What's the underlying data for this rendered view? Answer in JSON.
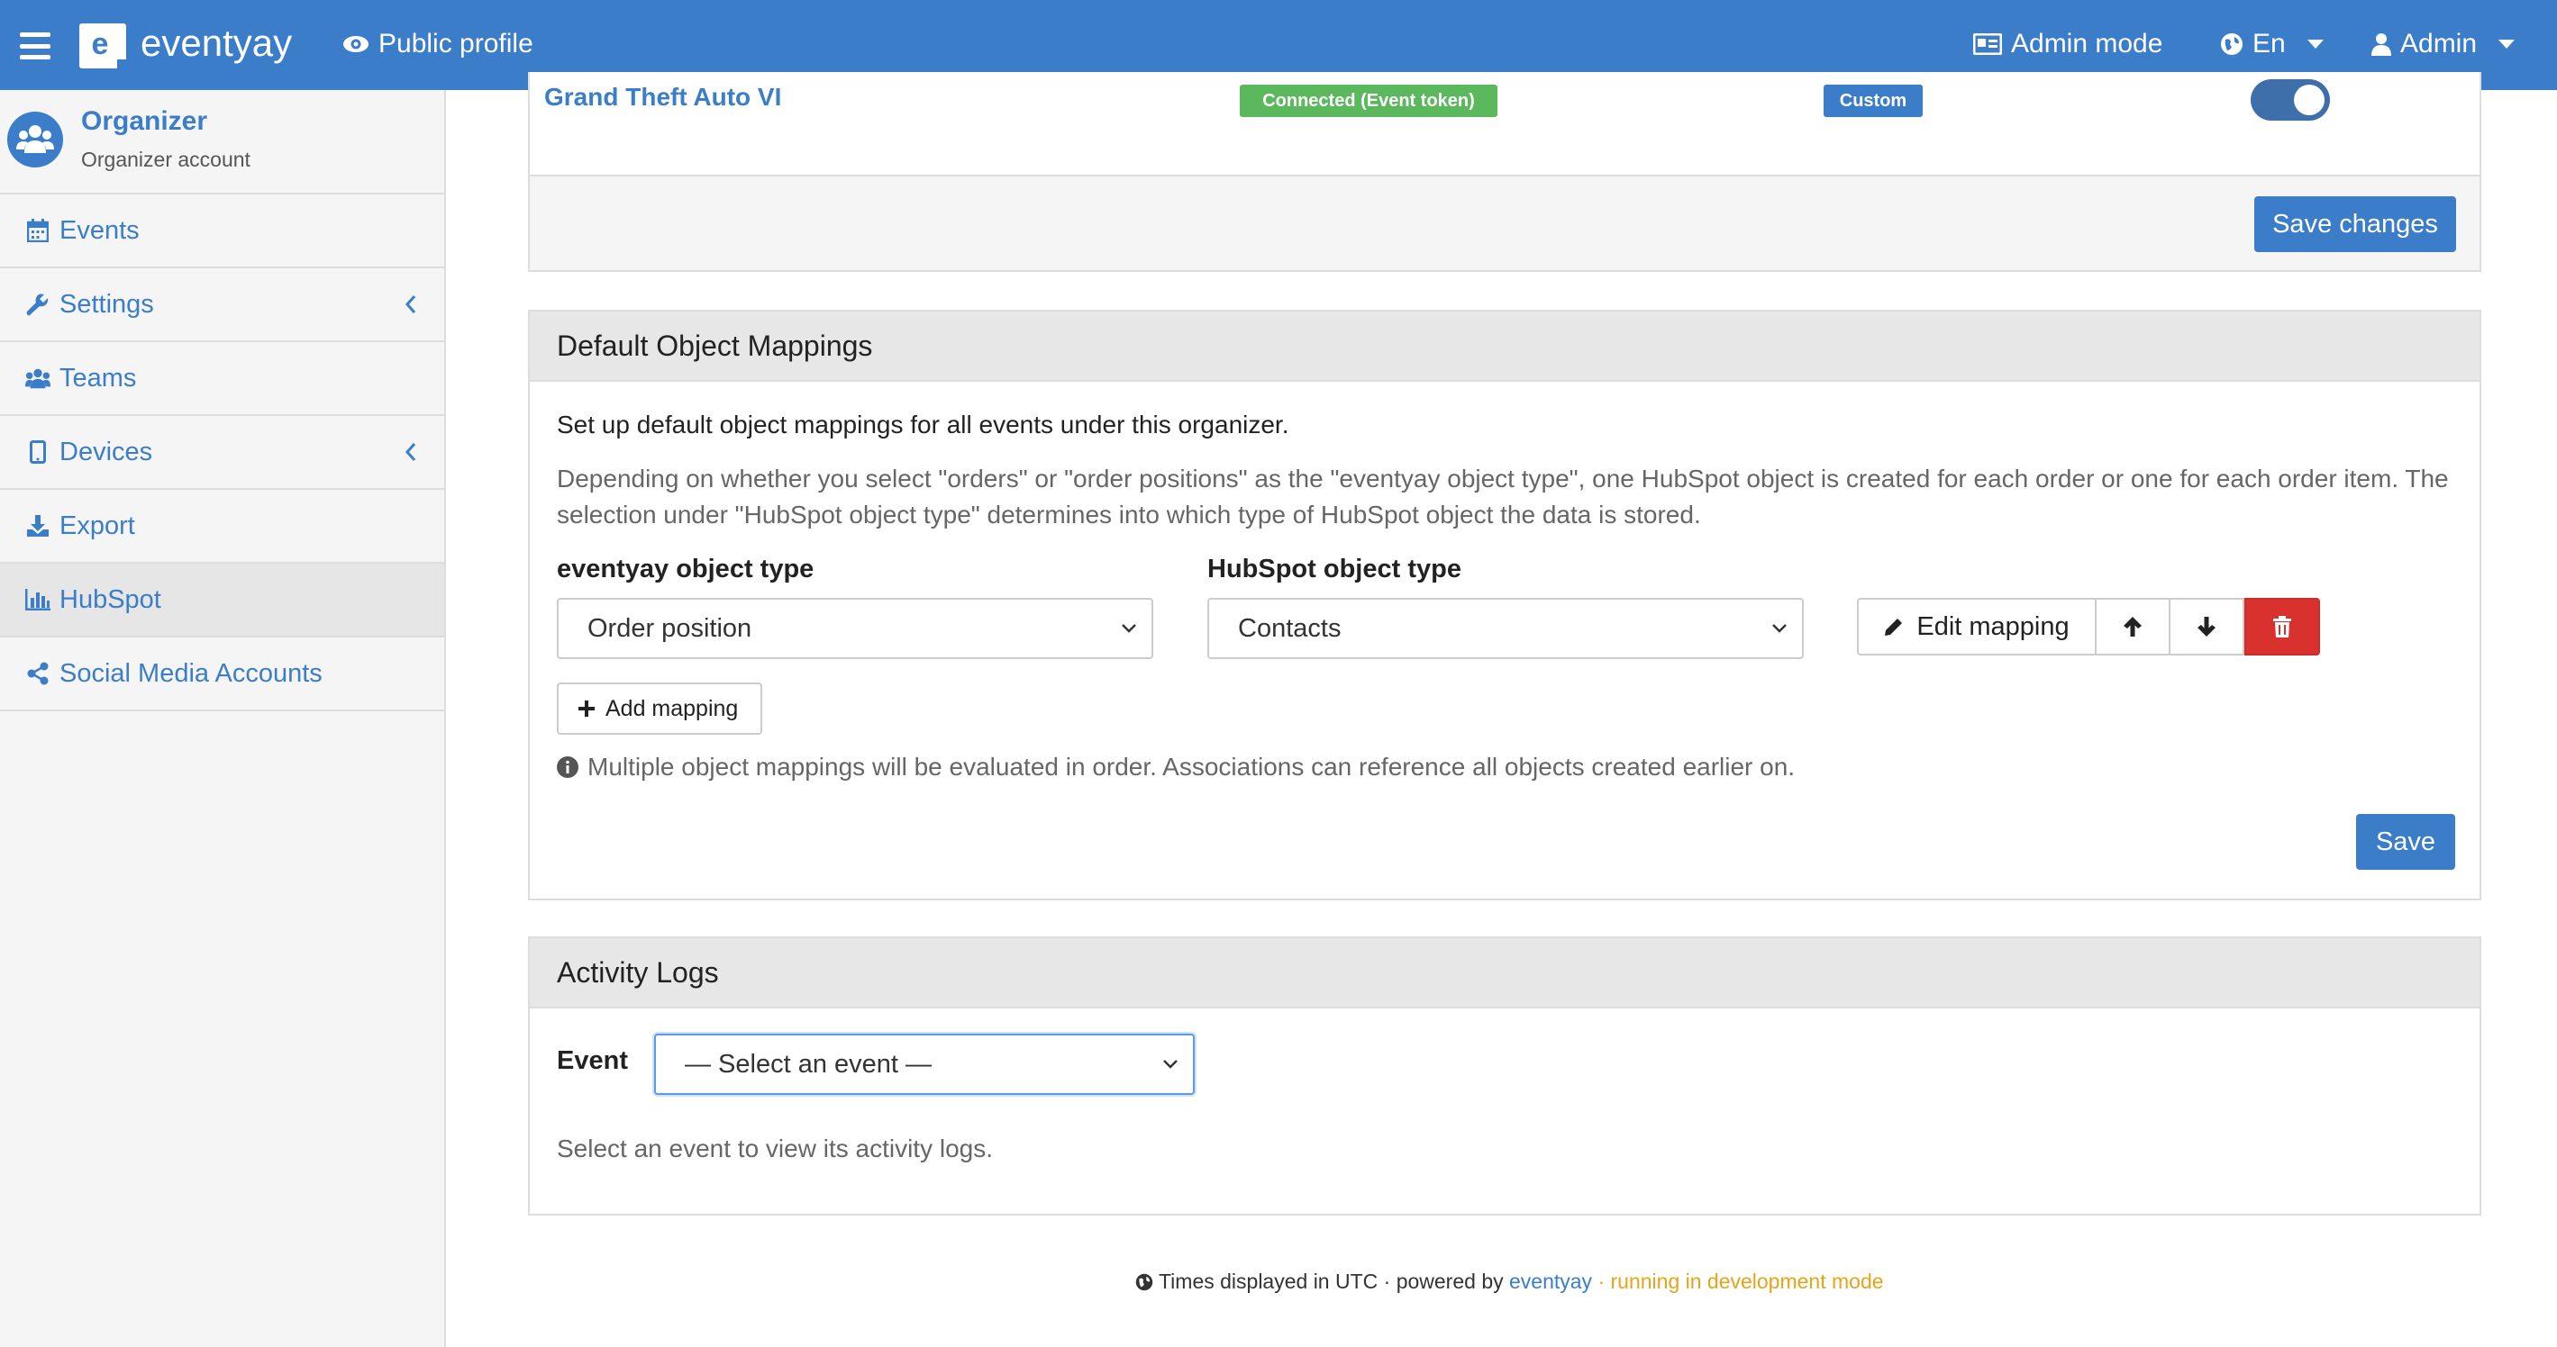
{
  "header": {
    "brand": "eventyay",
    "public_profile": "Public profile",
    "admin_mode": "Admin mode",
    "language": "En",
    "user": "Admin"
  },
  "sidebar": {
    "org_name": "Organizer",
    "org_sub": "Organizer account",
    "items": [
      {
        "label": "Events",
        "icon": "calendar-icon"
      },
      {
        "label": "Settings",
        "icon": "wrench-icon"
      },
      {
        "label": "Teams",
        "icon": "users-icon"
      },
      {
        "label": "Devices",
        "icon": "tablet-icon"
      },
      {
        "label": "Export",
        "icon": "download-icon"
      },
      {
        "label": "HubSpot",
        "icon": "bar-chart-icon",
        "active": true
      },
      {
        "label": "Social Media Accounts",
        "icon": "share-icon"
      }
    ]
  },
  "events_panel": {
    "event_name": "Grand Theft Auto VI",
    "status_badge": "Connected (Event token)",
    "mode_badge": "Custom",
    "toggle_on": true,
    "save_label": "Save changes"
  },
  "mappings_panel": {
    "title": "Default Object Mappings",
    "intro": "Set up default object mappings for all events under this organizer.",
    "help": "Depending on whether you select \"orders\" or \"order positions\" as the \"eventyay object type\", one HubSpot object is created for each order or one for each order item. The selection under \"HubSpot object type\" determines into which type of HubSpot object the data is stored.",
    "eventyay_type_label": "eventyay object type",
    "eventyay_type_value": "Order position",
    "hubspot_type_label": "HubSpot object type",
    "hubspot_type_value": "Contacts",
    "edit_mapping_label": "Edit mapping",
    "add_mapping_label": "Add mapping",
    "info_text": "Multiple object mappings will be evaluated in order. Associations can reference all objects created earlier on.",
    "save_label": "Save"
  },
  "logs_panel": {
    "title": "Activity Logs",
    "event_label": "Event",
    "event_select": "— Select an event —",
    "hint": "Select an event to view its activity logs."
  },
  "footer": {
    "times": "Times displayed in UTC · powered by",
    "brand_link": "eventyay",
    "dev_mode": "· running in development mode"
  },
  "colors": {
    "primary": "#3b7dc8",
    "success": "#5cb85c",
    "danger": "#d9322e",
    "warning": "#e8a317"
  }
}
